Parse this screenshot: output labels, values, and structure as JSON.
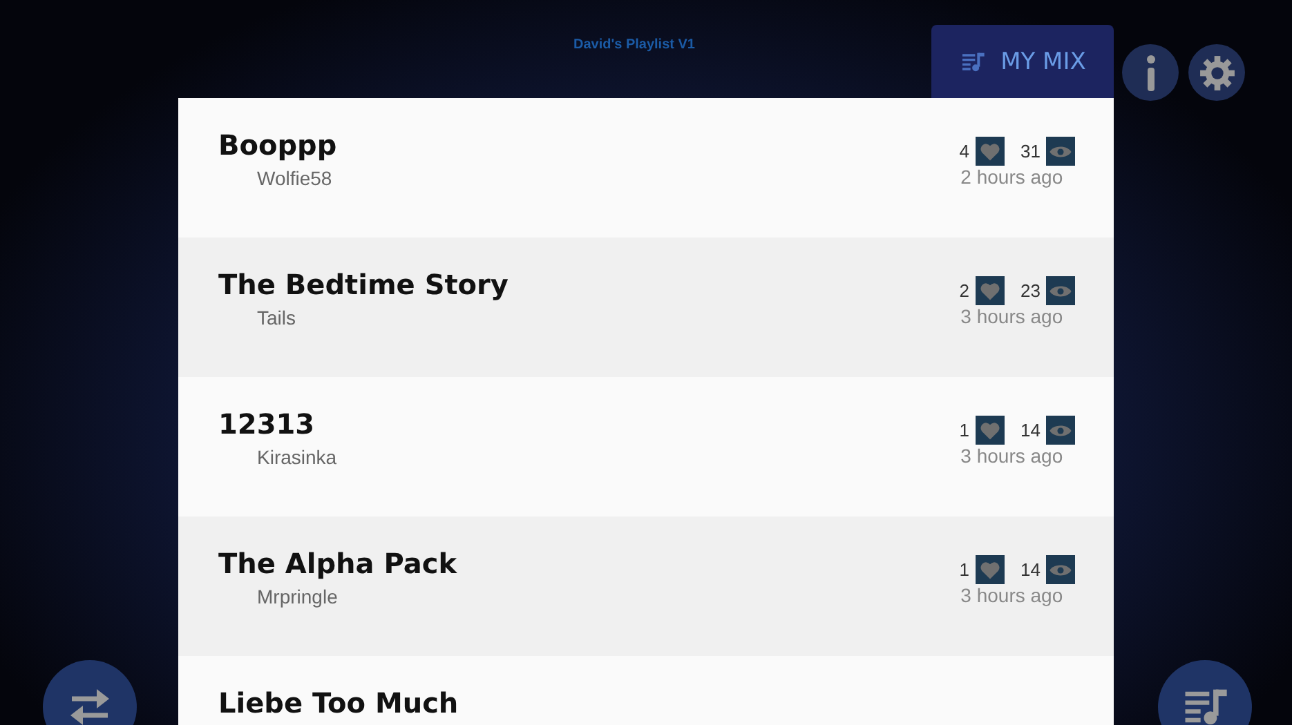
{
  "header": {
    "title": "David's Playlist V1",
    "mix_button": "MY MIX"
  },
  "rows": [
    {
      "title": "Booppp",
      "author": "Wolfie58",
      "likes": "4",
      "views": "31",
      "time": "2 hours ago"
    },
    {
      "title": "The Bedtime Story",
      "author": "Tails",
      "likes": "2",
      "views": "23",
      "time": "3 hours ago"
    },
    {
      "title": "12313",
      "author": "Kirasinka",
      "likes": "1",
      "views": "14",
      "time": "3 hours ago"
    },
    {
      "title": "The Alpha Pack",
      "author": "Mrpringle",
      "likes": "1",
      "views": "14",
      "time": "3 hours ago"
    },
    {
      "title": "Liebe Too Much"
    }
  ]
}
